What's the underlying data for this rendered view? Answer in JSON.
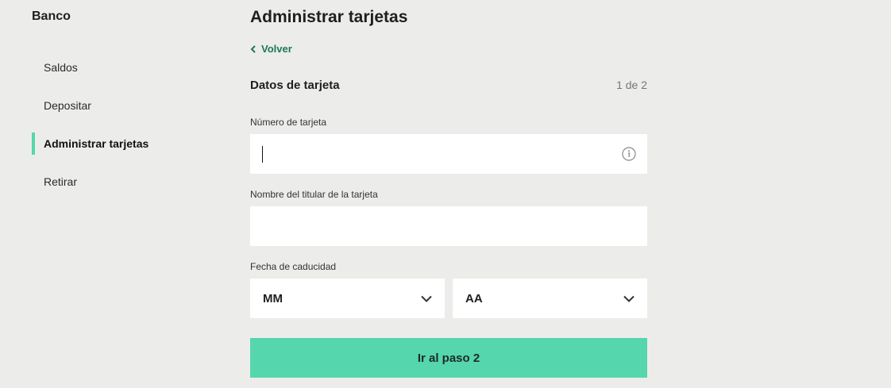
{
  "sidebar": {
    "brand": "Banco",
    "items": [
      {
        "label": "Saldos",
        "active": false
      },
      {
        "label": "Depositar",
        "active": false
      },
      {
        "label": "Administrar tarjetas",
        "active": true
      },
      {
        "label": "Retirar",
        "active": false
      }
    ]
  },
  "main": {
    "title": "Administrar tarjetas",
    "back_label": "Volver",
    "section_title": "Datos de tarjeta",
    "step": "1 de 2",
    "card_number": {
      "label": "Número de tarjeta",
      "value": "",
      "icon": "info-icon"
    },
    "holder_name": {
      "label": "Nombre del titular de la tarjeta",
      "value": ""
    },
    "expiry": {
      "label": "Fecha de caducidad",
      "month": "MM",
      "year": "AA"
    },
    "submit_label": "Ir al paso 2"
  },
  "colors": {
    "background": "#ececea",
    "accent": "#55d6ac",
    "link": "#1c7a55"
  }
}
